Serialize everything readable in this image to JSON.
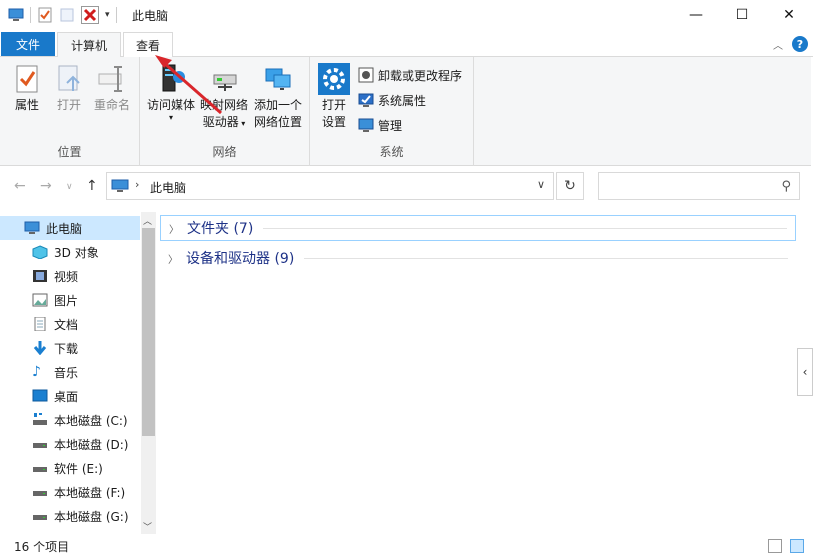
{
  "window": {
    "title": "此电脑",
    "minimize_icon": "minimize-icon",
    "maximize_icon": "maximize-icon",
    "close_icon": "close-icon"
  },
  "ribbon": {
    "tabs": [
      {
        "label": "文件"
      },
      {
        "label": "计算机"
      },
      {
        "label": "查看"
      }
    ],
    "groups": {
      "location": {
        "label": "位置",
        "buttons": [
          {
            "label": "属性"
          },
          {
            "label": "打开"
          },
          {
            "label": "重命名"
          }
        ]
      },
      "network": {
        "label": "网络",
        "buttons": [
          {
            "label": "访问媒体",
            "has_dropdown": true
          },
          {
            "label_line1": "映射网络",
            "label_line2": "驱动器",
            "has_dropdown": true
          },
          {
            "label_line1": "添加一个",
            "label_line2": "网络位置"
          }
        ]
      },
      "system": {
        "label": "系统",
        "big_button": {
          "label_line1": "打开",
          "label_line2": "设置"
        },
        "small_buttons": [
          {
            "label": "卸载或更改程序"
          },
          {
            "label": "系统属性"
          },
          {
            "label": "管理"
          }
        ]
      }
    }
  },
  "address": {
    "path": "此电脑",
    "search_placeholder": ""
  },
  "nav_pane": {
    "items": [
      {
        "label": "此电脑",
        "icon": "computer-icon",
        "selected": true
      },
      {
        "label": "3D 对象",
        "icon": "3d-objects-icon"
      },
      {
        "label": "视频",
        "icon": "video-icon"
      },
      {
        "label": "图片",
        "icon": "pictures-icon"
      },
      {
        "label": "文档",
        "icon": "documents-icon"
      },
      {
        "label": "下载",
        "icon": "download-icon"
      },
      {
        "label": "音乐",
        "icon": "music-icon"
      },
      {
        "label": "桌面",
        "icon": "desktop-icon"
      },
      {
        "label": "本地磁盘 (C:)",
        "icon": "system-drive-icon"
      },
      {
        "label": "本地磁盘 (D:)",
        "icon": "drive-icon"
      },
      {
        "label": "软件 (E:)",
        "icon": "drive-icon"
      },
      {
        "label": "本地磁盘 (F:)",
        "icon": "drive-icon"
      },
      {
        "label": "本地磁盘 (G:)",
        "icon": "drive-icon"
      }
    ]
  },
  "content": {
    "groups": [
      {
        "title": "文件夹 (7)"
      },
      {
        "title": "设备和驱动器 (9)"
      }
    ]
  },
  "status": {
    "item_count": "16 个项目"
  },
  "colors": {
    "accent": "#1979ca",
    "selection": "#cce8ff",
    "group_title": "#1e3287",
    "annotation_arrow": "#d9262b"
  }
}
